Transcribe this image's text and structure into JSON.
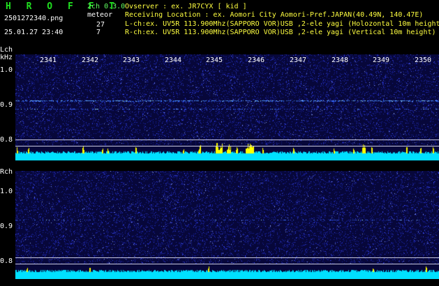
{
  "header": {
    "brand": "H R O F F T",
    "filename": "2501272340.png",
    "datetime": "25.01.27 23:40",
    "version": "2ch 0.3.0",
    "meteor_label": "meteor",
    "lch_count": "27",
    "rch_count": "7",
    "observer": "Ovserver            : ex. JR7CYX [ kid ]",
    "location": "Receiving Location : ex. Aomori City Aomori-Pref.JAPAN(40.49N, 140.47E)",
    "lch_info": "L-ch:ex. UV5R 113.900Mhz(SAPPORO VOR)USB ,2-ele yagi (Holozontal 10m height",
    "rch_info": "R-ch:ex. UV5R 113.900Mhz(SAPPORO VOR)USB ,2-ele yagi (Vertical 10m height)"
  },
  "lch": {
    "label": "Lch",
    "unit": "kHz",
    "yticks": [
      "1.0",
      "0.9",
      "0.8"
    ]
  },
  "rch": {
    "label": "Rch",
    "yticks": [
      "1.0",
      "0.9",
      "0.8"
    ]
  },
  "xticks": [
    "2341",
    "2342",
    "2343",
    "2344",
    "2345",
    "2346",
    "2347",
    "2348",
    "2349",
    "2350"
  ],
  "colors": {
    "background": "#000000",
    "brand": "#20e020",
    "info": "#ffff40",
    "panel": "#08083a",
    "noise": "#3a50ff",
    "baseline": "#00e8ff",
    "meteor": "#ffff00"
  }
}
